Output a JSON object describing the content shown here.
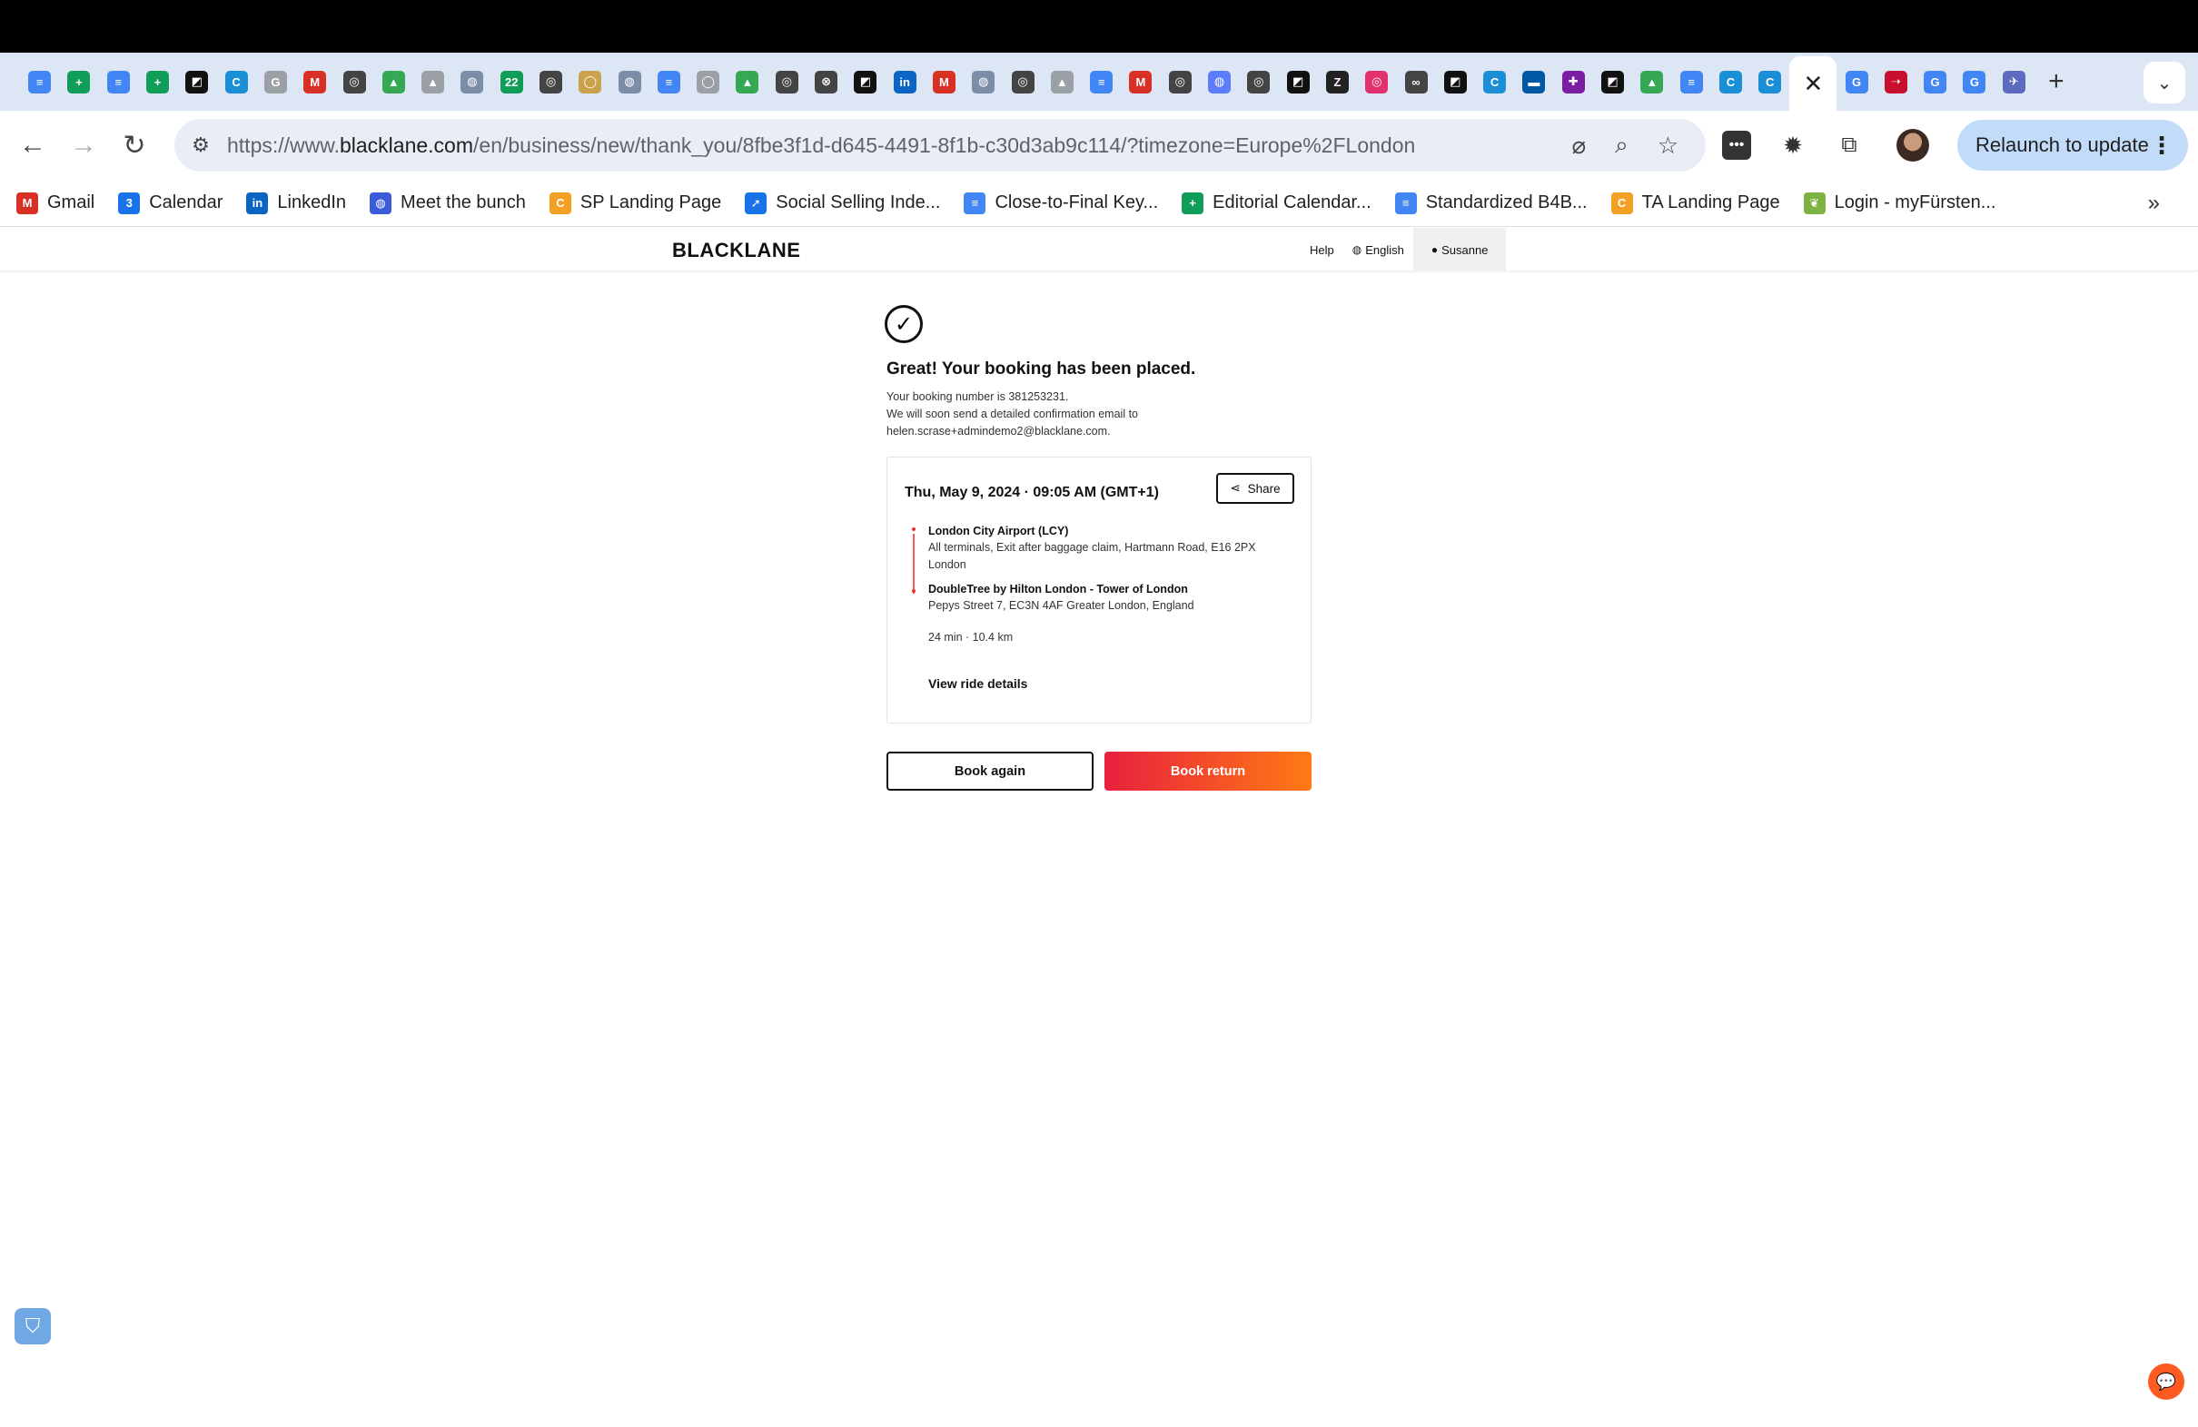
{
  "browser": {
    "tabs": [
      {
        "icon": "docs-icon",
        "color": "#4285f4",
        "glyph": "≡"
      },
      {
        "icon": "sheets-icon",
        "color": "#0f9d58",
        "glyph": "+"
      },
      {
        "icon": "docs-icon",
        "color": "#4285f4",
        "glyph": "≡"
      },
      {
        "icon": "sheets-icon",
        "color": "#0f9d58",
        "glyph": "+"
      },
      {
        "icon": "app-icon",
        "color": "#111111",
        "glyph": "◩"
      },
      {
        "icon": "canva-icon",
        "color": "#1b8fd6",
        "glyph": "C"
      },
      {
        "icon": "google-icon",
        "color": "#9aa0a6",
        "glyph": "G"
      },
      {
        "icon": "gmail-icon",
        "color": "#d93025",
        "glyph": "M"
      },
      {
        "icon": "openai-icon",
        "color": "#444444",
        "glyph": "◎"
      },
      {
        "icon": "drive-icon",
        "color": "#34a853",
        "glyph": "▲"
      },
      {
        "icon": "drive-icon",
        "color": "#9aa0a6",
        "glyph": "▲"
      },
      {
        "icon": "globe-icon",
        "color": "#7b8ea8",
        "glyph": "◍"
      },
      {
        "icon": "calendar-icon",
        "color": "#0f9d58",
        "glyph": "22"
      },
      {
        "icon": "openai-icon",
        "color": "#444444",
        "glyph": "◎"
      },
      {
        "icon": "circle-icon",
        "color": "#c9a24b",
        "glyph": "◯"
      },
      {
        "icon": "globe-icon",
        "color": "#7b8ea8",
        "glyph": "◍"
      },
      {
        "icon": "docs-icon",
        "color": "#4285f4",
        "glyph": "≡"
      },
      {
        "icon": "circle-icon",
        "color": "#9aa0a6",
        "glyph": "◯"
      },
      {
        "icon": "drive-icon",
        "color": "#34a853",
        "glyph": "▲"
      },
      {
        "icon": "openai-icon",
        "color": "#444444",
        "glyph": "◎"
      },
      {
        "icon": "x-circle-icon",
        "color": "#444444",
        "glyph": "⊗"
      },
      {
        "icon": "app-icon",
        "color": "#111111",
        "glyph": "◩"
      },
      {
        "icon": "linkedin-icon",
        "color": "#0a66c2",
        "glyph": "in"
      },
      {
        "icon": "gmail-icon",
        "color": "#d93025",
        "glyph": "M"
      },
      {
        "icon": "globe-icon",
        "color": "#7b8ea8",
        "glyph": "◍"
      },
      {
        "icon": "openai-icon",
        "color": "#444444",
        "glyph": "◎"
      },
      {
        "icon": "drive-icon",
        "color": "#9aa0a6",
        "glyph": "▲"
      },
      {
        "icon": "docs-icon",
        "color": "#4285f4",
        "glyph": "≡"
      },
      {
        "icon": "gmail-icon",
        "color": "#d93025",
        "glyph": "M"
      },
      {
        "icon": "openai-icon",
        "color": "#444444",
        "glyph": "◎"
      },
      {
        "icon": "globe-icon",
        "color": "#5c7cfa",
        "glyph": "◍"
      },
      {
        "icon": "openai-icon",
        "color": "#444444",
        "glyph": "◎"
      },
      {
        "icon": "app-icon",
        "color": "#111111",
        "glyph": "◩"
      },
      {
        "icon": "zara-icon",
        "color": "#222222",
        "glyph": "Z"
      },
      {
        "icon": "instagram-icon",
        "color": "#e1306c",
        "glyph": "◎"
      },
      {
        "icon": "link-icon",
        "color": "#444444",
        "glyph": "∞"
      },
      {
        "icon": "app-icon",
        "color": "#111111",
        "glyph": "◩"
      },
      {
        "icon": "canva-icon",
        "color": "#1b8fd6",
        "glyph": "C"
      },
      {
        "icon": "ikea-icon",
        "color": "#0058a3",
        "glyph": "▬"
      },
      {
        "icon": "target-icon",
        "color": "#7b1fa2",
        "glyph": "✚"
      },
      {
        "icon": "app-icon",
        "color": "#111111",
        "glyph": "◩"
      },
      {
        "icon": "drive-icon",
        "color": "#34a853",
        "glyph": "▲"
      },
      {
        "icon": "docs-icon",
        "color": "#4285f4",
        "glyph": "≡"
      },
      {
        "icon": "canva-icon",
        "color": "#1b8fd6",
        "glyph": "C"
      },
      {
        "icon": "canva-icon",
        "color": "#1b8fd6",
        "glyph": "C"
      }
    ],
    "tabs_after_active": [
      {
        "icon": "google-icon",
        "color": "#4285f4",
        "glyph": "G"
      },
      {
        "icon": "airline-icon",
        "color": "#c8102e",
        "glyph": "➝"
      },
      {
        "icon": "google-icon",
        "color": "#4285f4",
        "glyph": "G"
      },
      {
        "icon": "google-icon",
        "color": "#4285f4",
        "glyph": "G"
      },
      {
        "icon": "plane-icon",
        "color": "#5c6bc0",
        "glyph": "✈"
      }
    ],
    "url_scheme": "https://www.",
    "url_host": "blacklane.com",
    "url_path": "/en/business/new/thank_you/8fbe3f1d-d645-4491-8f1b-c30d3ab9c114/?timezone=Europe%2FLondon",
    "relaunch_label": "Relaunch to update",
    "bookmarks": [
      {
        "label": "Gmail",
        "icon": "gmail-icon",
        "color": "#d93025",
        "glyph": "M"
      },
      {
        "label": "Calendar",
        "icon": "calendar-icon",
        "color": "#1a73e8",
        "glyph": "3"
      },
      {
        "label": "LinkedIn",
        "icon": "linkedin-icon",
        "color": "#0a66c2",
        "glyph": "in"
      },
      {
        "label": "Meet the bunch",
        "icon": "globe-icon",
        "color": "#3b5bdb",
        "glyph": "◍"
      },
      {
        "label": "SP Landing Page",
        "icon": "canva-icon",
        "color": "#f4a024",
        "glyph": "C"
      },
      {
        "label": "Social Selling Inde...",
        "icon": "compass-icon",
        "color": "#1a73e8",
        "glyph": "➚"
      },
      {
        "label": "Close-to-Final Key...",
        "icon": "docs-icon",
        "color": "#4285f4",
        "glyph": "≡"
      },
      {
        "label": "Editorial Calendar...",
        "icon": "sheets-icon",
        "color": "#0f9d58",
        "glyph": "+"
      },
      {
        "label": "Standardized B4B...",
        "icon": "docs-icon",
        "color": "#4285f4",
        "glyph": "≡"
      },
      {
        "label": "TA Landing Page",
        "icon": "canva-icon",
        "color": "#f4a024",
        "glyph": "C"
      },
      {
        "label": "Login - myFürsten...",
        "icon": "leaf-icon",
        "color": "#7cb342",
        "glyph": "❦"
      }
    ]
  },
  "site": {
    "logo": "BLACKLANE",
    "nav": {
      "help": "Help",
      "language": "English",
      "user": "Susanne"
    }
  },
  "confirmation": {
    "title": "Great! Your booking has been placed.",
    "booking_line": "Your booking number is 381253231.",
    "email_line1": "We will soon send a detailed confirmation email to",
    "email_line2": "helen.scrase+admindemo2@blacklane.com."
  },
  "ride": {
    "date": "Thu, May 9, 2024",
    "time": "09:05 AM (GMT+1)",
    "share_label": "Share",
    "pickup_name": "London City Airport (LCY)",
    "pickup_addr1": "All terminals, Exit after baggage claim, Hartmann Road, E16 2PX",
    "pickup_addr2": "London",
    "dropoff_name": "DoubleTree by Hilton London - Tower of London",
    "dropoff_addr": "Pepys Street 7, EC3N 4AF Greater London, England",
    "duration": "24 min",
    "distance": "10.4 km",
    "details_link": "View ride details"
  },
  "actions": {
    "book_again": "Book again",
    "book_return": "Book return"
  },
  "colors": {
    "accent_start": "#e8203e",
    "accent_end": "#ff7a14",
    "route_line": "#e33333"
  }
}
